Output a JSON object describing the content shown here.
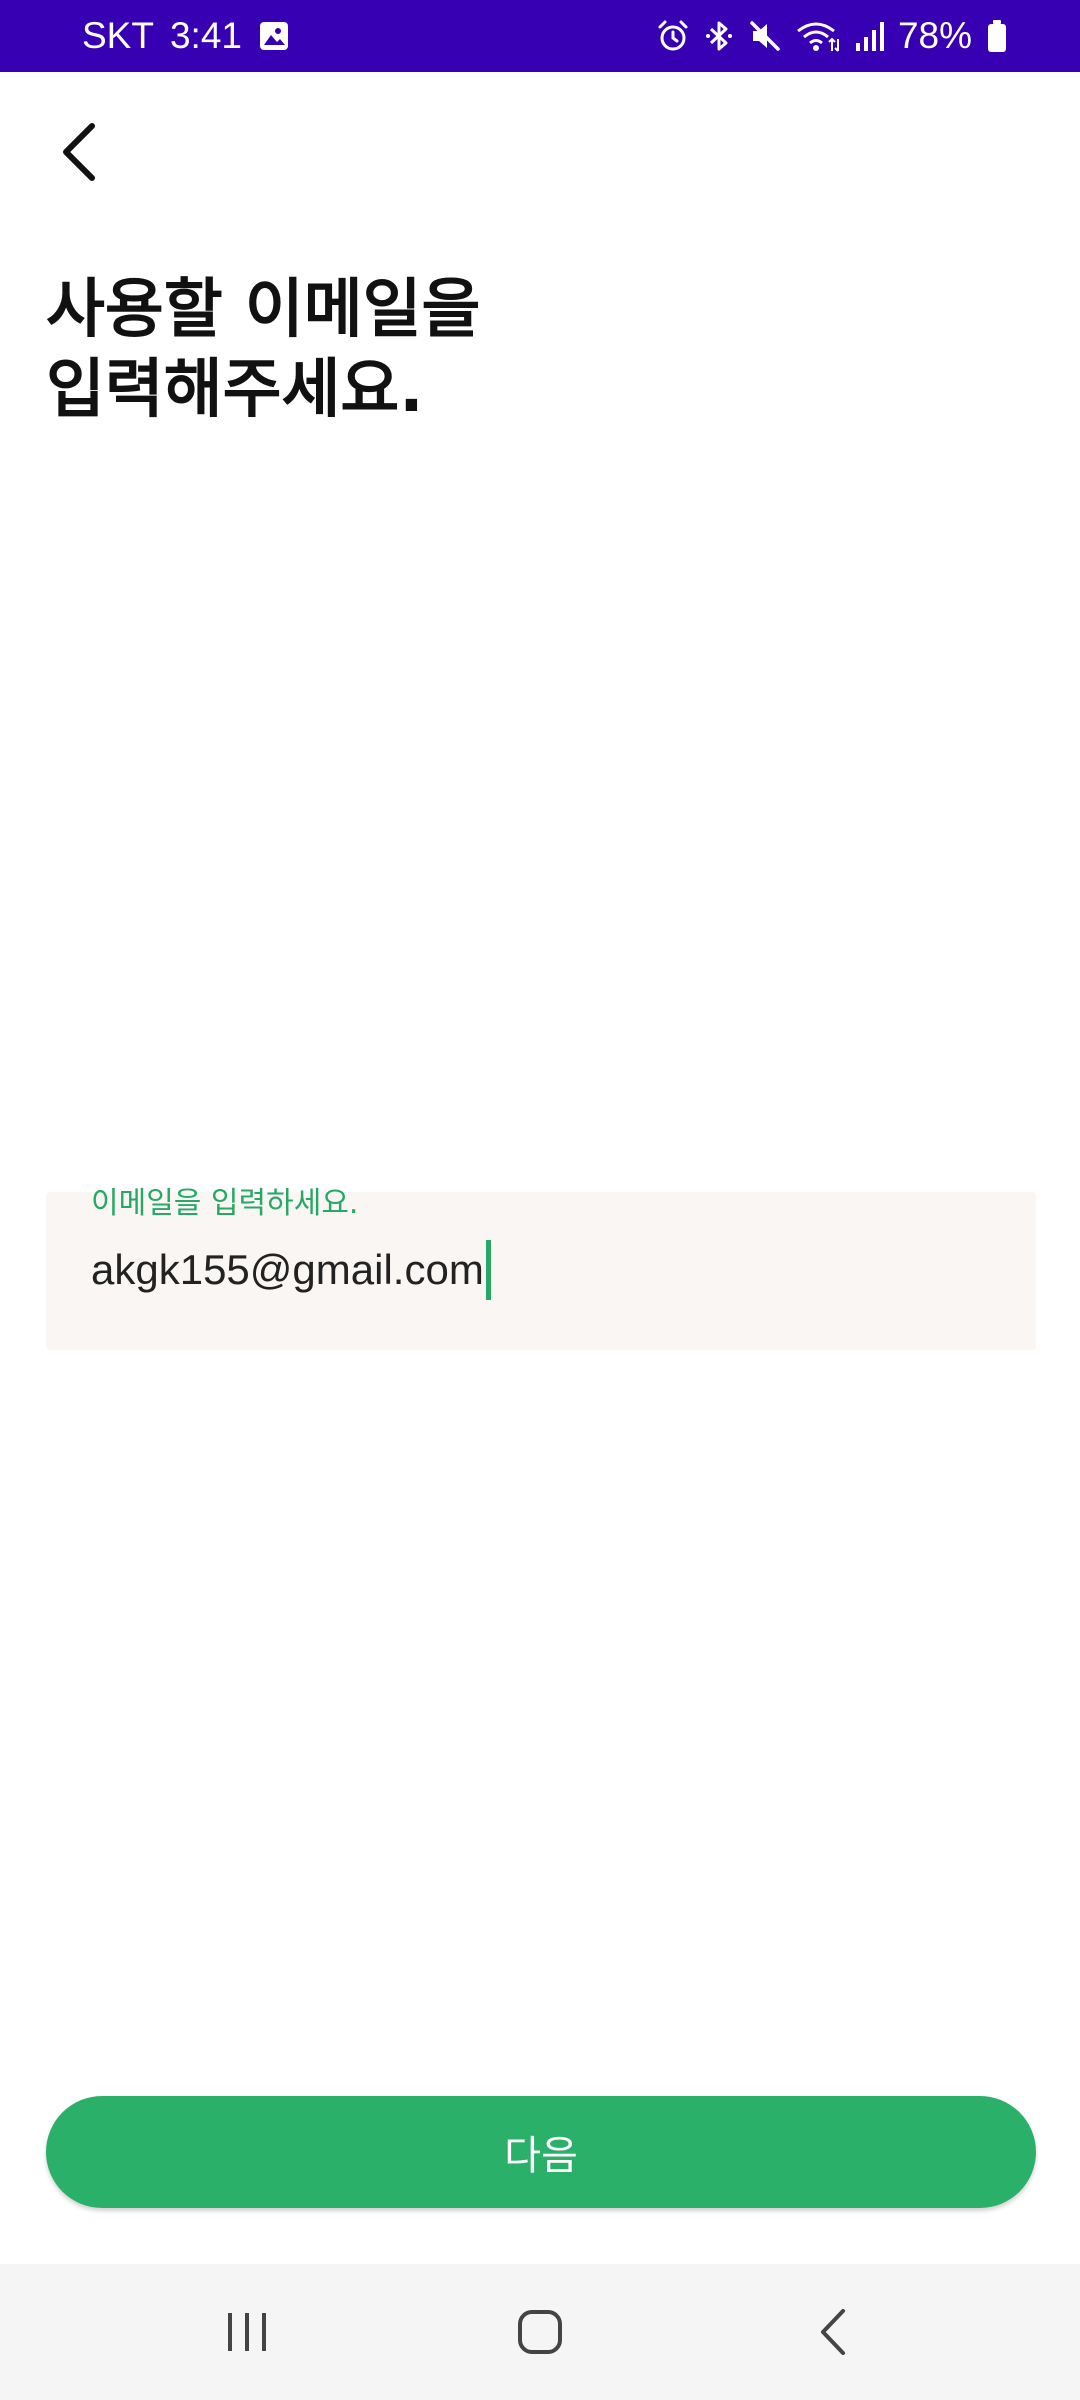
{
  "status_bar": {
    "carrier": "SKT",
    "time": "3:41",
    "battery_percent": "78%",
    "background_color": "#3700b3",
    "left_icons": [
      "gallery-icon"
    ],
    "right_icons": [
      "alarm-icon",
      "bluetooth-icon",
      "mute-icon",
      "wifi-icon",
      "signal-icon",
      "battery-icon"
    ]
  },
  "header": {
    "back_icon": "chevron-left-icon"
  },
  "title": {
    "line1": "사용할 이메일을",
    "line2": "입력해주세요."
  },
  "email_field": {
    "label": "이메일을 입력하세요.",
    "value": "akgk155@gmail.com",
    "accent_color": "#27a866"
  },
  "next_button": {
    "label": "다음",
    "color": "#2bb06a"
  },
  "nav_bar": {
    "buttons": [
      "recent-apps-icon",
      "home-icon",
      "back-icon"
    ]
  }
}
